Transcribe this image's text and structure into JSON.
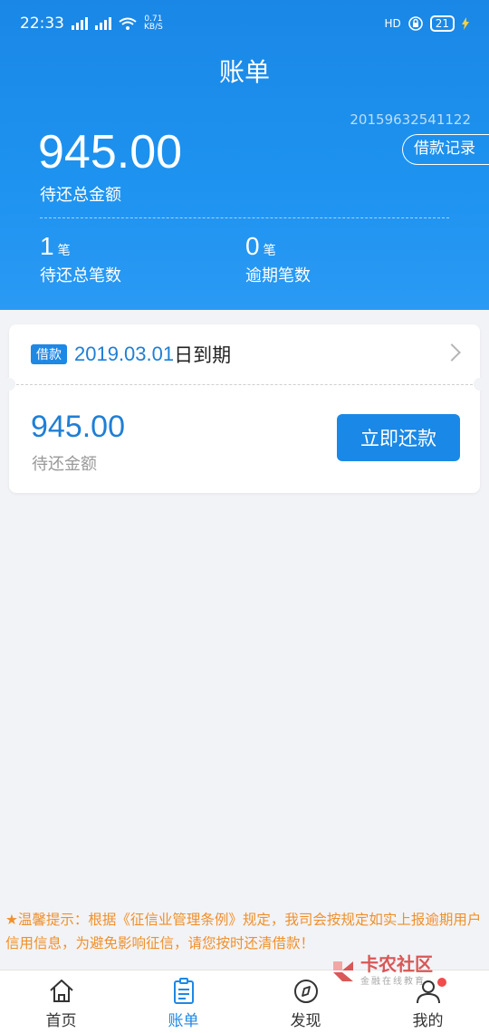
{
  "status_bar": {
    "time": "22:33",
    "net_speed": "0.71",
    "net_speed_unit": "KB/S",
    "hd_label": "HD",
    "battery": "21"
  },
  "header": {
    "title": "账单",
    "account_no": "20159632541122",
    "loan_record_label": "借款记录",
    "total_amount": "945.00",
    "total_label": "待还总金额",
    "pending_count": "1",
    "pending_unit": "笔",
    "pending_label": "待还总笔数",
    "overdue_count": "0",
    "overdue_unit": "笔",
    "overdue_label": "逾期笔数"
  },
  "bill_card": {
    "tag": "借款",
    "due_date": "2019.03.01",
    "due_suffix": "日到期",
    "amount": "945.00",
    "amount_label": "待还金额",
    "repay_button": "立即还款"
  },
  "notice": "★温馨提示：根据《征信业管理条例》规定，我司会按规定如实上报逾期用户信用信息，为避免影响征信，请您按时还清借款！",
  "watermark": {
    "title": "卡农社区",
    "subtitle": "金融在线教育"
  },
  "tabs": [
    {
      "label": "首页",
      "icon": "home-icon"
    },
    {
      "label": "账单",
      "icon": "bill-icon"
    },
    {
      "label": "发现",
      "icon": "compass-icon"
    },
    {
      "label": "我的",
      "icon": "user-icon"
    }
  ],
  "colors": {
    "primary": "#1e88e5",
    "notice": "#f0902a",
    "badge": "#f04c4c"
  }
}
